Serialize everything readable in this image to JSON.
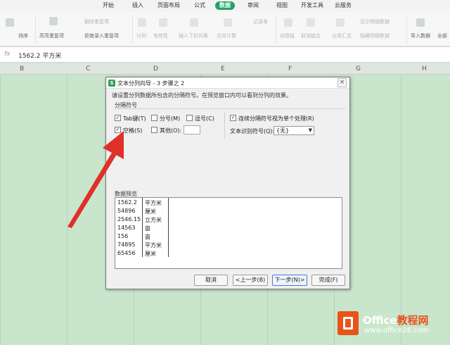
{
  "ribbon": {
    "tabs": [
      "开始",
      "插入",
      "页面布局",
      "公式",
      "数据",
      "审阅",
      "视图",
      "开发工具",
      "云服务"
    ],
    "active_tab": "数据",
    "items": {
      "sort": "排序",
      "highlight_dup": "高亮重复项",
      "remove_dup": "删除重复项",
      "reject_dup": "拒绝录入重复项",
      "split": "分列",
      "validity": "有效性",
      "dropdown": "插入下拉列表",
      "consolidate": "合并计算",
      "record": "记录单",
      "create_group": "创建组",
      "ungroup": "取消组合",
      "subtotal": "分类汇总",
      "show_detail": "显示明细数据",
      "hide_detail": "隐藏明细数据",
      "import": "导入数据",
      "all": "全部"
    }
  },
  "formula_bar": {
    "fx": "fx",
    "value": "1562.2 平方米"
  },
  "columns": [
    "B",
    "C",
    "D",
    "E",
    "F",
    "G",
    "H"
  ],
  "dialog": {
    "title": "文本分列向导 - 3 步骤之 2",
    "icon": "S",
    "close": "×",
    "instruction": "请设置分列数据所包含的分隔符号。在预览窗口内可以看到分列的效果。",
    "group_label": "分隔符号",
    "checkboxes": {
      "tab": {
        "label": "Tab键(T)",
        "checked": true
      },
      "semicolon": {
        "label": "分号(M)",
        "checked": false
      },
      "comma": {
        "label": "逗号(C)",
        "checked": false
      },
      "space": {
        "label": "空格(S)",
        "checked": true
      },
      "other": {
        "label": "其他(O):",
        "checked": false
      },
      "consecutive": {
        "label": "连续分隔符号视为单个处理(R)",
        "checked": true
      }
    },
    "qualifier_label": "文本识别符号(Q):",
    "qualifier_value": "{无}",
    "preview_label": "数据预览",
    "preview_rows": [
      [
        "1562.2",
        "平方米"
      ],
      [
        "54896",
        "厘米"
      ],
      [
        "2546.15",
        "立方米"
      ],
      [
        "14563",
        "亩"
      ],
      [
        "156",
        "亩"
      ],
      [
        "74895",
        "平方米"
      ],
      [
        "65456",
        "厘米"
      ]
    ],
    "buttons": {
      "cancel": "取消",
      "back": "<上一步(B)",
      "next": "下一步(N)>",
      "finish": "完成(F)"
    }
  },
  "watermark": {
    "brand_a": "Office",
    "brand_b": "教程网",
    "url": "www.office26.com"
  },
  "colors": {
    "accent": "#21a366",
    "sheet": "#c9e6cc",
    "arrow": "#e0302a",
    "logo": "#e8531c"
  }
}
